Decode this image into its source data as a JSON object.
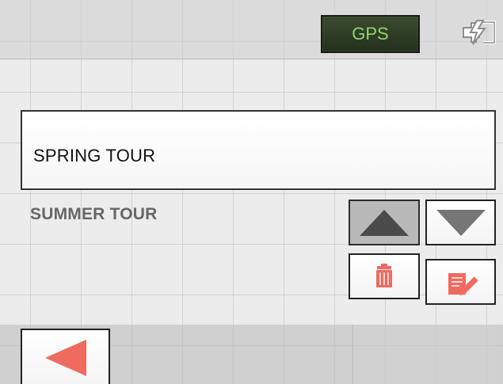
{
  "header": {
    "gps_label": "GPS",
    "power_icon": "charging-plug-icon"
  },
  "routes": {
    "selected_item": "SPRING TOUR",
    "items": [
      "SUMMER TOUR"
    ]
  },
  "controls": {
    "up_icon": "arrow-up-icon",
    "down_icon": "arrow-down-icon",
    "delete_icon": "trash-icon",
    "edit_icon": "edit-document-icon",
    "back_icon": "back-arrow-icon"
  },
  "colors": {
    "gps_text": "#93d26e",
    "gps_bg": "#24311d",
    "accent_red": "#ef6a5f",
    "grid_bg": "#ececec"
  }
}
